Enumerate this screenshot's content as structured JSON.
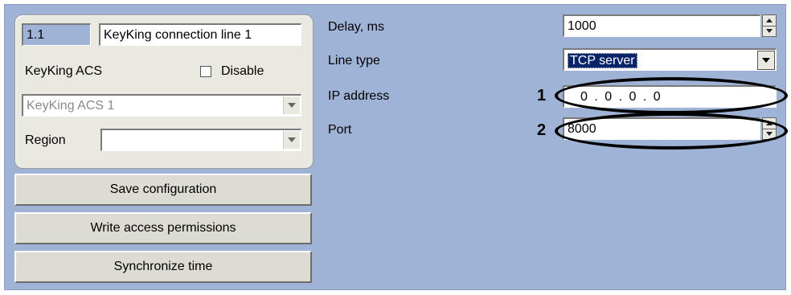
{
  "left": {
    "id_value": "1.1",
    "name_value": "KeyKing connection line 1",
    "acs_label": "KeyKing ACS",
    "disable_label": "Disable",
    "acs_select_value": "KeyKing ACS 1",
    "region_label": "Region",
    "region_value": ""
  },
  "buttons": {
    "save": "Save configuration",
    "write": "Write access permissions",
    "sync": "Synchronize time"
  },
  "right": {
    "delay_label": "Delay, ms",
    "delay_value": "1000",
    "line_type_label": "Line type",
    "line_type_value": "TCP server",
    "ip_label": "IP address",
    "ip_value": "0 . 0 . 0 . 0",
    "port_label": "Port",
    "port_value": "8000"
  },
  "callouts": {
    "ip": "1",
    "port": "2"
  },
  "colors": {
    "background": "#9fb3d6",
    "panel": "#e9e9e2",
    "selection": "#0a246a"
  }
}
